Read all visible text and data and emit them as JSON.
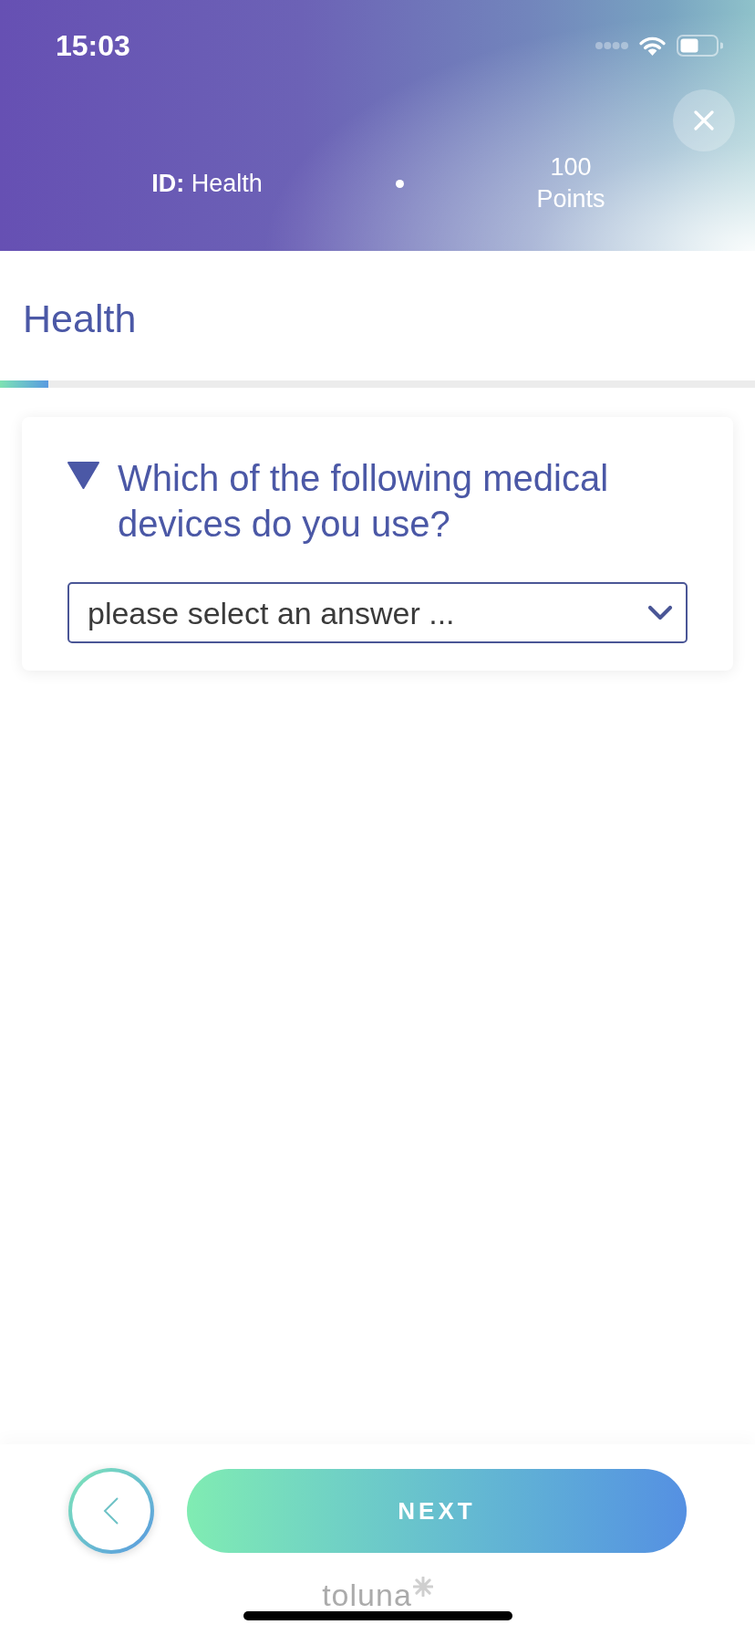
{
  "status_bar": {
    "time": "15:03"
  },
  "header": {
    "survey_id": "**ID:** Health",
    "points": "100",
    "points_label": "Points"
  },
  "page": {
    "title": "Health",
    "progress": {
      "level": 0.064
    }
  },
  "question": {
    "text": "Which of the following medical devices do you use?",
    "dropdown": {
      "placeholder": "please select an answer ..."
    }
  },
  "footer": {
    "next_button": "NEXT",
    "brand": "toluna"
  }
}
